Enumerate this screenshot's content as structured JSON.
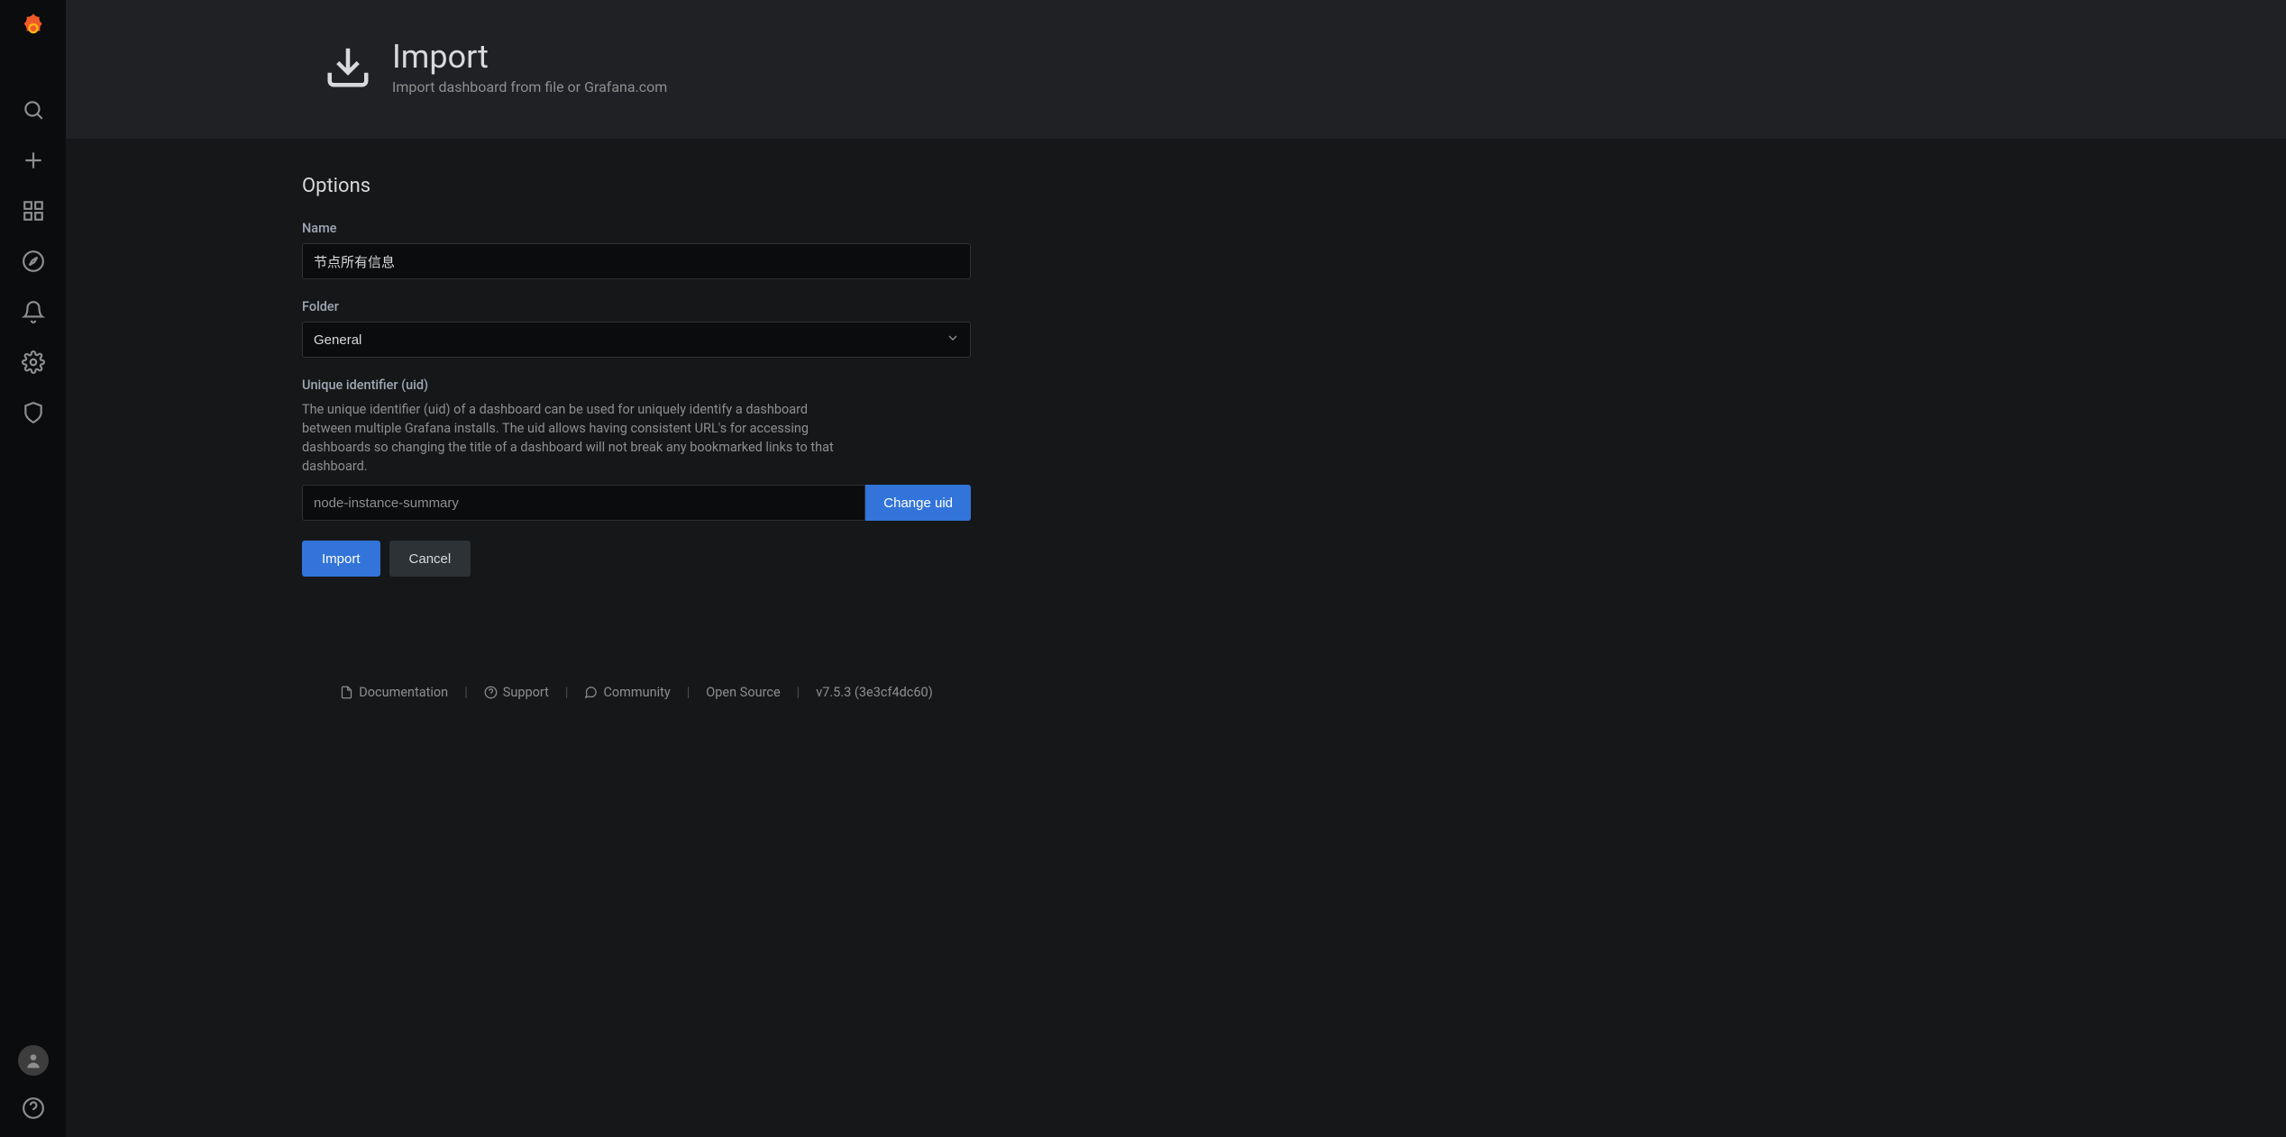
{
  "header": {
    "title": "Import",
    "subtitle": "Import dashboard from file or Grafana.com"
  },
  "section_title": "Options",
  "fields": {
    "name": {
      "label": "Name",
      "value": "节点所有信息"
    },
    "folder": {
      "label": "Folder",
      "value": "General"
    },
    "uid": {
      "label": "Unique identifier (uid)",
      "help": "The unique identifier (uid) of a dashboard can be used for uniquely identify a dashboard between multiple Grafana installs. The uid allows having consistent URL's for accessing dashboards so changing the title of a dashboard will not break any bookmarked links to that dashboard.",
      "value": "node-instance-summary",
      "change_label": "Change uid"
    }
  },
  "actions": {
    "import": "Import",
    "cancel": "Cancel"
  },
  "footer": {
    "documentation": "Documentation",
    "support": "Support",
    "community": "Community",
    "open_source": "Open Source",
    "version": "v7.5.3 (3e3cf4dc60)"
  }
}
